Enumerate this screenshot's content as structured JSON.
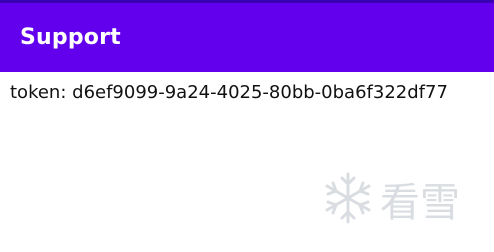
{
  "app_bar": {
    "title": "Support"
  },
  "content": {
    "token_label": "token:",
    "token_value": "d6ef9099-9a24-4025-80bb-0ba6f322df77"
  },
  "watermark": {
    "text": "看雪",
    "icon": "snowflake-icon"
  },
  "colors": {
    "primary": "#6200ee",
    "primary_dark": "#3a00b3",
    "on_primary": "#ffffff",
    "text": "#111111",
    "watermark": "#d9dde2"
  }
}
